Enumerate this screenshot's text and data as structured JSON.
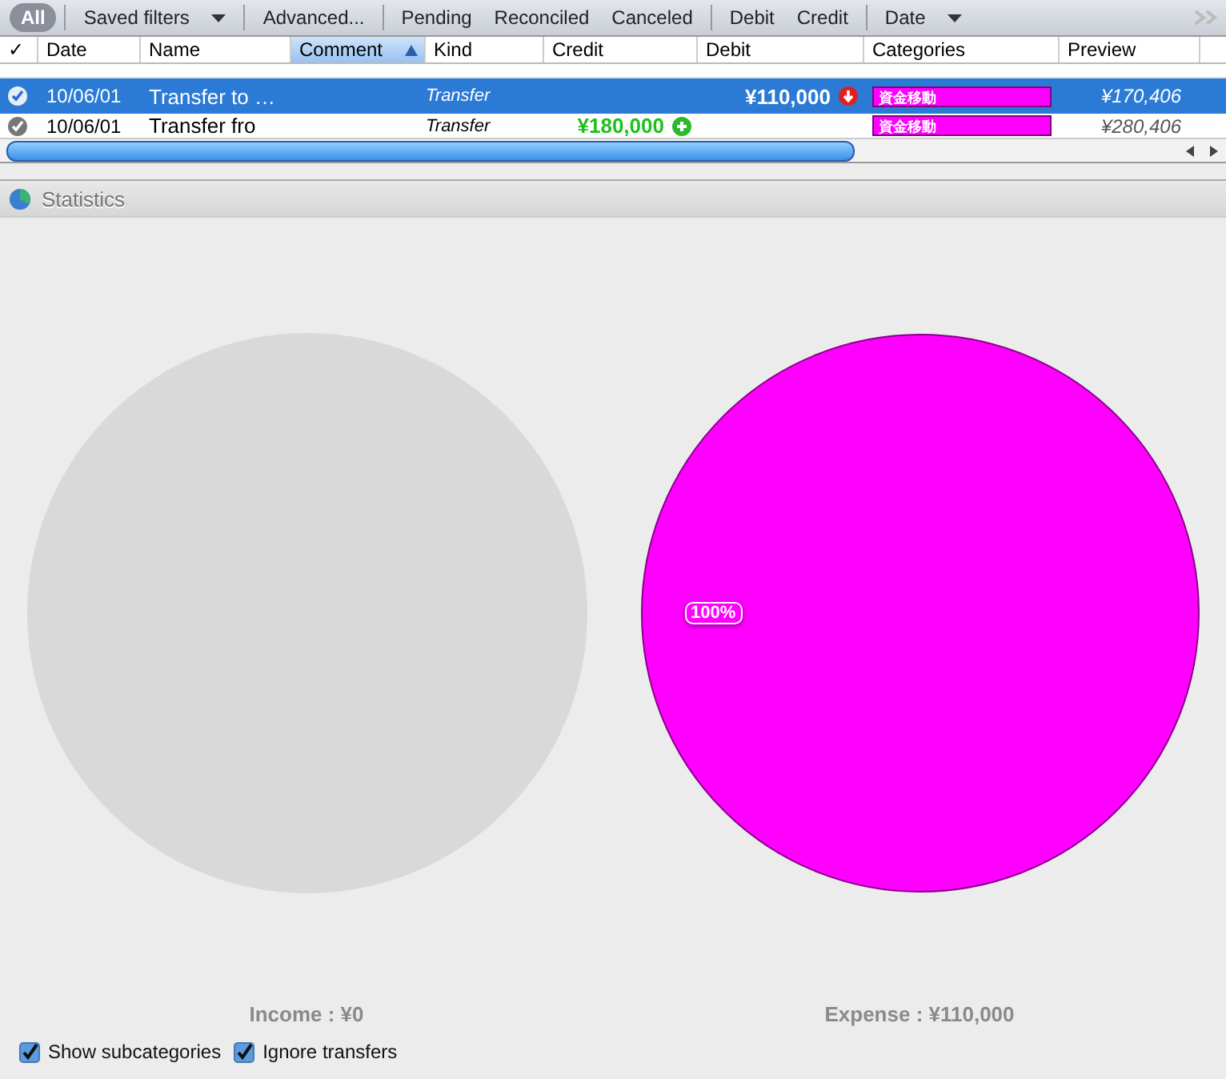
{
  "toolbar": {
    "filters": [
      {
        "label": "All",
        "selected": true,
        "kind": "pill"
      },
      {
        "label": "Saved filters",
        "selected": false,
        "kind": "menu"
      },
      {
        "label": "Advanced...",
        "selected": false,
        "kind": "plain"
      },
      {
        "label": "Pending",
        "selected": false,
        "kind": "plain"
      },
      {
        "label": "Reconciled",
        "selected": false,
        "kind": "plain"
      },
      {
        "label": "Canceled",
        "selected": false,
        "kind": "plain"
      },
      {
        "label": "Debit",
        "selected": false,
        "kind": "plain"
      },
      {
        "label": "Credit",
        "selected": false,
        "kind": "plain"
      },
      {
        "label": "Date",
        "selected": false,
        "kind": "menu"
      }
    ]
  },
  "table": {
    "columns": [
      {
        "label": "✓",
        "sorted": false
      },
      {
        "label": "Date",
        "sorted": false
      },
      {
        "label": "Name",
        "sorted": false
      },
      {
        "label": "Comment",
        "sorted": true
      },
      {
        "label": "Kind",
        "sorted": false
      },
      {
        "label": "Credit",
        "sorted": false
      },
      {
        "label": "Debit",
        "sorted": false
      },
      {
        "label": "Categories",
        "sorted": false
      },
      {
        "label": "Preview",
        "sorted": false
      }
    ],
    "rows": [
      {
        "selected": true,
        "checked": true,
        "date": "10/06/01",
        "name": "Transfer to …",
        "kind": "Transfer",
        "credit": "",
        "debit": "¥110,000",
        "category": "資金移動",
        "preview": "¥170,406"
      },
      {
        "selected": false,
        "checked": true,
        "date": "10/06/01",
        "name": "Transfer fro",
        "kind": "Transfer",
        "credit": "¥180,000",
        "debit": "",
        "category": "資金移動",
        "preview": "¥280,406"
      }
    ]
  },
  "statistics": {
    "title": "Statistics",
    "income_chart": {
      "label": "Income : ¥0"
    },
    "expense_chart": {
      "label": "Expense : ¥110,000",
      "chart_data": {
        "type": "pie",
        "values": [
          100
        ],
        "value_labels": [
          "100%"
        ]
      }
    },
    "options": [
      {
        "label": "Show subcategories",
        "checked": true
      },
      {
        "label": "Ignore transfers",
        "checked": true
      }
    ]
  }
}
